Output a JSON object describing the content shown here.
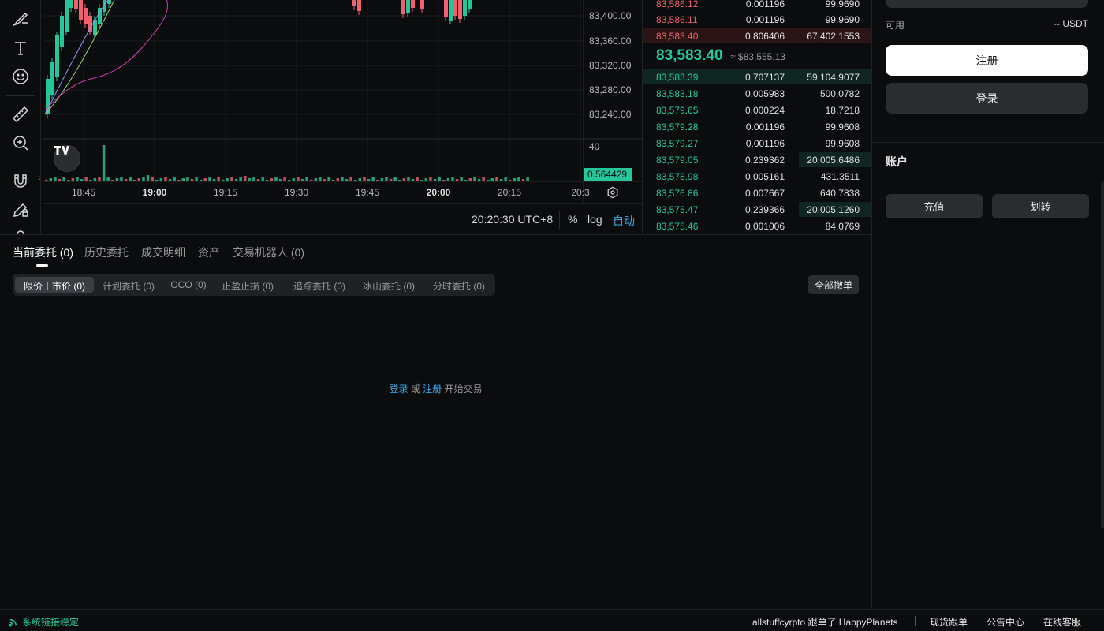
{
  "chart": {
    "price_ticks": [
      "83,400.00",
      "83,360.00",
      "83,320.00",
      "83,280.00",
      "83,240.00"
    ],
    "volume_tick": "40",
    "volume_label": "0.564429",
    "time_ticks": [
      "18:45",
      "19:00",
      "19:15",
      "19:30",
      "19:45",
      "20:00",
      "20:15",
      "20:3"
    ],
    "clock": "20:20:30 UTC+8",
    "percent_label": "%",
    "log_label": "log",
    "auto_label": "自动"
  },
  "orderbook": {
    "asks": [
      {
        "price": "83,586.12",
        "amount": "0.001196",
        "total": "99.9690"
      },
      {
        "price": "83,586.11",
        "amount": "0.001196",
        "total": "99.9690"
      },
      {
        "price": "83,583.40",
        "amount": "0.806406",
        "total": "67,402.1553"
      }
    ],
    "mid_price": "83,583.40",
    "mid_fiat": "≈ $83,555.13",
    "bids": [
      {
        "price": "83,583.39",
        "amount": "0.707137",
        "total": "59,104.9077"
      },
      {
        "price": "83,583.18",
        "amount": "0.005983",
        "total": "500.0782"
      },
      {
        "price": "83,579.65",
        "amount": "0.000224",
        "total": "18.7218"
      },
      {
        "price": "83,579.28",
        "amount": "0.001196",
        "total": "99.9608"
      },
      {
        "price": "83,579.27",
        "amount": "0.001196",
        "total": "99.9608"
      },
      {
        "price": "83,579.05",
        "amount": "0.239362",
        "total": "20,005.6486"
      },
      {
        "price": "83,578.98",
        "amount": "0.005161",
        "total": "431.3511"
      },
      {
        "price": "83,576.86",
        "amount": "0.007667",
        "total": "640.7838"
      },
      {
        "price": "83,575.47",
        "amount": "0.239366",
        "total": "20,005.1260"
      },
      {
        "price": "83,575.46",
        "amount": "0.001006",
        "total": "84.0769"
      }
    ]
  },
  "panel": {
    "available_label": "可用",
    "available_value": "-- USDT",
    "register_label": "注册",
    "login_label": "登录",
    "account_title": "账户",
    "deposit_label": "充值",
    "transfer_label": "划转"
  },
  "orders": {
    "tabs": [
      {
        "label": "当前委托 (0)"
      },
      {
        "label": "历史委托"
      },
      {
        "label": "成交明细"
      },
      {
        "label": "资产"
      },
      {
        "label": "交易机器人 (0)"
      }
    ],
    "subtabs": [
      {
        "label": "限价丨市价 (0)"
      },
      {
        "label": "计划委托 (0)"
      },
      {
        "label": "OCO (0)"
      },
      {
        "label": "止盈止损 (0)"
      },
      {
        "label": "追踪委托 (0)"
      },
      {
        "label": "冰山委托 (0)"
      },
      {
        "label": "分时委托 (0)"
      }
    ],
    "cancel_all_label": "全部撤单",
    "empty": {
      "login": "登录",
      "or": " 或 ",
      "register": "注册",
      "suffix": " 开始交易"
    }
  },
  "statusbar": {
    "connection": "系统链接稳定",
    "ticker": "allstuffcyrpto 跟单了 HappyPlanets",
    "copy_trading": "现货跟单",
    "announcements": "公告中心",
    "support": "在线客服"
  },
  "colors": {
    "up": "#25c79a",
    "down": "#f0616d",
    "link": "#3ea8e8",
    "background": "#0b0c0d"
  }
}
